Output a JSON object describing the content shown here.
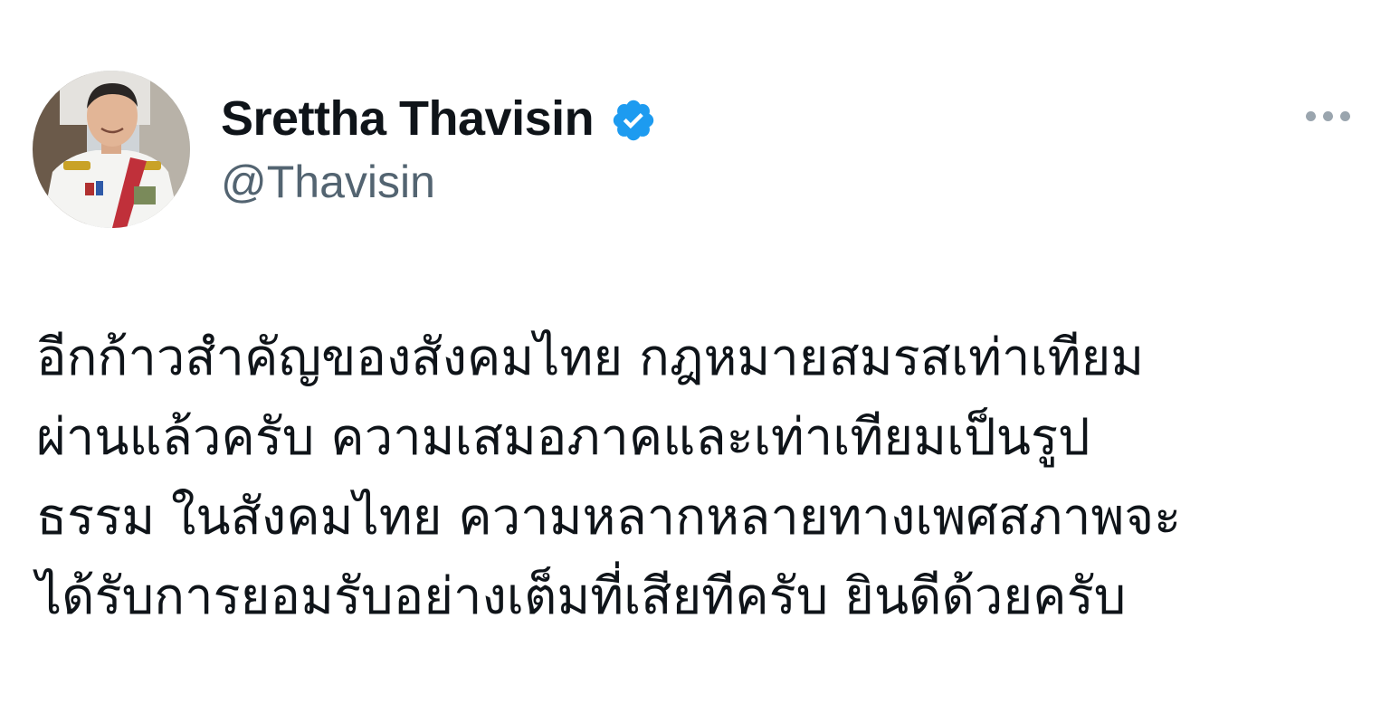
{
  "author": {
    "display_name": "Srettha Thavisin",
    "handle": "@Thavisin",
    "verified": true,
    "verified_color": "#1d9bf0",
    "avatar_icon": "profile-photo"
  },
  "more_icon": "more-horizontal-icon",
  "tweet": {
    "lines": [
      "อีกก้าวสำคัญของสังคมไทย กฎหมายสมรสเท่าเทียม",
      "ผ่านแล้วครับ  ความเสมอภาคและเท่าเทียมเป็นรูป",
      "ธรรม ในสังคมไทย ความหลากหลายทางเพศสภาพจะ",
      "ได้รับการยอมรับอย่างเต็มที่เสียทีครับ ยินดีด้วยครับ"
    ]
  },
  "colors": {
    "text_primary": "#0f1419",
    "text_secondary": "#536471",
    "background": "#ffffff"
  }
}
